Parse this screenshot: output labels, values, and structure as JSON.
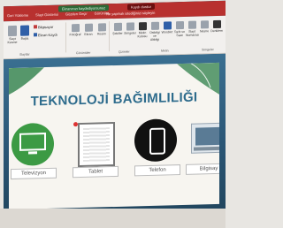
{
  "window": {
    "recording_banner": "Ekranınızı kaydediyorsunuz",
    "stop_button": "Kaydı durdur",
    "tell_me": "Ne yapmak istediğinizi söyleyin",
    "menu": [
      "Geri Yükleme",
      "Slayt Gösterisi",
      "Gözden Geçir",
      "Görünüm"
    ]
  },
  "ribbon": {
    "buttons": [
      {
        "label": "Slayt Kesme",
        "icon": "slide-icon"
      },
      {
        "label": "Başla",
        "icon": "start-icon"
      },
      {
        "label": "Bilgisayar",
        "icon": "computer-icon"
      },
      {
        "label": "Kaydet",
        "icon": "save-icon"
      },
      {
        "label": "Fotoğraf",
        "icon": "photo-icon"
      },
      {
        "label": "Ekran",
        "icon": "screen-icon"
      },
      {
        "label": "Resim",
        "icon": "image-icon"
      },
      {
        "label": "Şekiller",
        "icon": "shapes-icon"
      },
      {
        "label": "Simgeler",
        "icon": "icons-icon"
      },
      {
        "label": "Metin Kutusu",
        "icon": "textbox-icon"
      },
      {
        "label": "Üstbilgi ve Altbilgi",
        "icon": "header-icon"
      },
      {
        "label": "WordArt",
        "icon": "wordart-icon"
      },
      {
        "label": "Tarih ve Saat",
        "icon": "datetime-icon"
      },
      {
        "label": "Slayt Numarası",
        "icon": "slidenumber-icon"
      },
      {
        "label": "Nesne",
        "icon": "object-icon"
      },
      {
        "label": "Denklem",
        "icon": "equation-icon"
      }
    ],
    "groups": [
      "Slaytlar",
      "Görüntüler",
      "Çizimler",
      "Metin",
      "Simgeler"
    ],
    "list_items": [
      "Bilgisayar",
      "Ekran Kaydı"
    ]
  },
  "slide": {
    "title": "TEKNOLOJİ BAĞIMLILIĞI",
    "cards": [
      {
        "caption": "Televizyon",
        "icon": "tv-icon"
      },
      {
        "caption": "Tablet",
        "icon": "tablet-icon"
      },
      {
        "caption": "Telefon",
        "icon": "phone-icon"
      },
      {
        "caption": "Bilgisay",
        "icon": "computer-icon"
      }
    ]
  },
  "colors": {
    "titlebar": "#b8312f",
    "slide_title": "#2d6b8c",
    "slide_bg": "#2b5777"
  }
}
